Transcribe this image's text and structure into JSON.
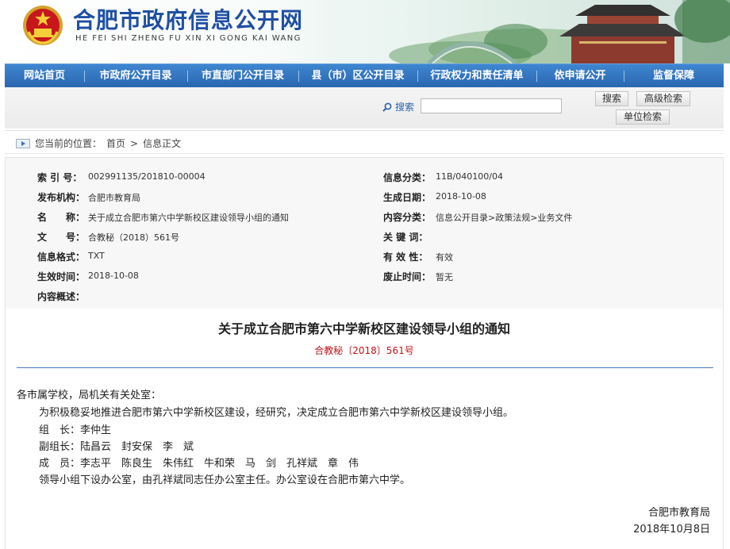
{
  "header": {
    "title": "合肥市政府信息公开网",
    "pinyin": "HE FEI SHI ZHENG FU XIN XI GONG KAI WANG",
    "emblem_icon": "national-emblem-icon"
  },
  "nav": {
    "items": [
      {
        "label": "网站首页"
      },
      {
        "label": "市政府公开目录"
      },
      {
        "label": "市直部门公开目录"
      },
      {
        "label": "县（市）区公开目录"
      },
      {
        "label": "行政权力和责任清单"
      },
      {
        "label": "依申请公开"
      },
      {
        "label": "监督保障"
      }
    ],
    "colors": {
      "bar": "#2f72bf",
      "text": "#ffffff"
    }
  },
  "search": {
    "label": "搜索",
    "value": "",
    "search_button": "搜索",
    "advanced_button": "高级检索",
    "unit_button": "单位检索"
  },
  "breadcrumb": {
    "prefix": "您当前的位置：",
    "home": "首页",
    "separator": ">",
    "current": "信息正文"
  },
  "meta": {
    "index_label": "索 引 号：",
    "index_value": "002991135/201810-00004",
    "category_label": "信息分类：",
    "category_value": "11B/040100/04",
    "publisher_label": "发布机构：",
    "publisher_value": "合肥市教育局",
    "date_label": "生成日期：",
    "date_value": "2018-10-08",
    "name_label": "名　　称：",
    "name_value": "关于成立合肥市第六中学新校区建设领导小组的通知",
    "content_category_label": "内容分类：",
    "content_category_value": "信息公开目录>政策法规>业务文件",
    "doc_no_label": "文　　号：",
    "doc_no_value": "合教秘（2018）561号",
    "keywords_label": "关 键 词：",
    "keywords_value": "",
    "format_label": "信息格式：",
    "format_value": "TXT",
    "validity_label": "有 效 性：",
    "validity_value": "有效",
    "effective_label": "生效时间：",
    "effective_value": "2018-10-08",
    "expiry_label": "废止时间：",
    "expiry_value": "暂无",
    "summary_label": "内容概述：",
    "summary_value": ""
  },
  "document": {
    "title": "关于成立合肥市第六中学新校区建设领导小组的通知",
    "number": "合教秘〔2018〕561号",
    "salutation": "各市属学校，局机关有关处室：",
    "paragraph1": "为积极稳妥地推进合肥市第六中学新校区建设，经研究，决定成立合肥市第六中学新校区建设领导小组。",
    "leader": "组　长：李仲生",
    "deputy": "副组长：陆昌云　封安保　李　斌",
    "members": "成　员：李志平　陈良生　朱伟红　牛和荣　马　剑　孔祥斌　章　伟",
    "paragraph2": "领导小组下设办公室，由孔祥斌同志任办公室主任。办公室设在合肥市第六中学。",
    "signature": "合肥市教育局",
    "sign_date": "2018年10月8日",
    "colors": {
      "number": "#c0151b",
      "rule": "#4a7ec0"
    }
  }
}
